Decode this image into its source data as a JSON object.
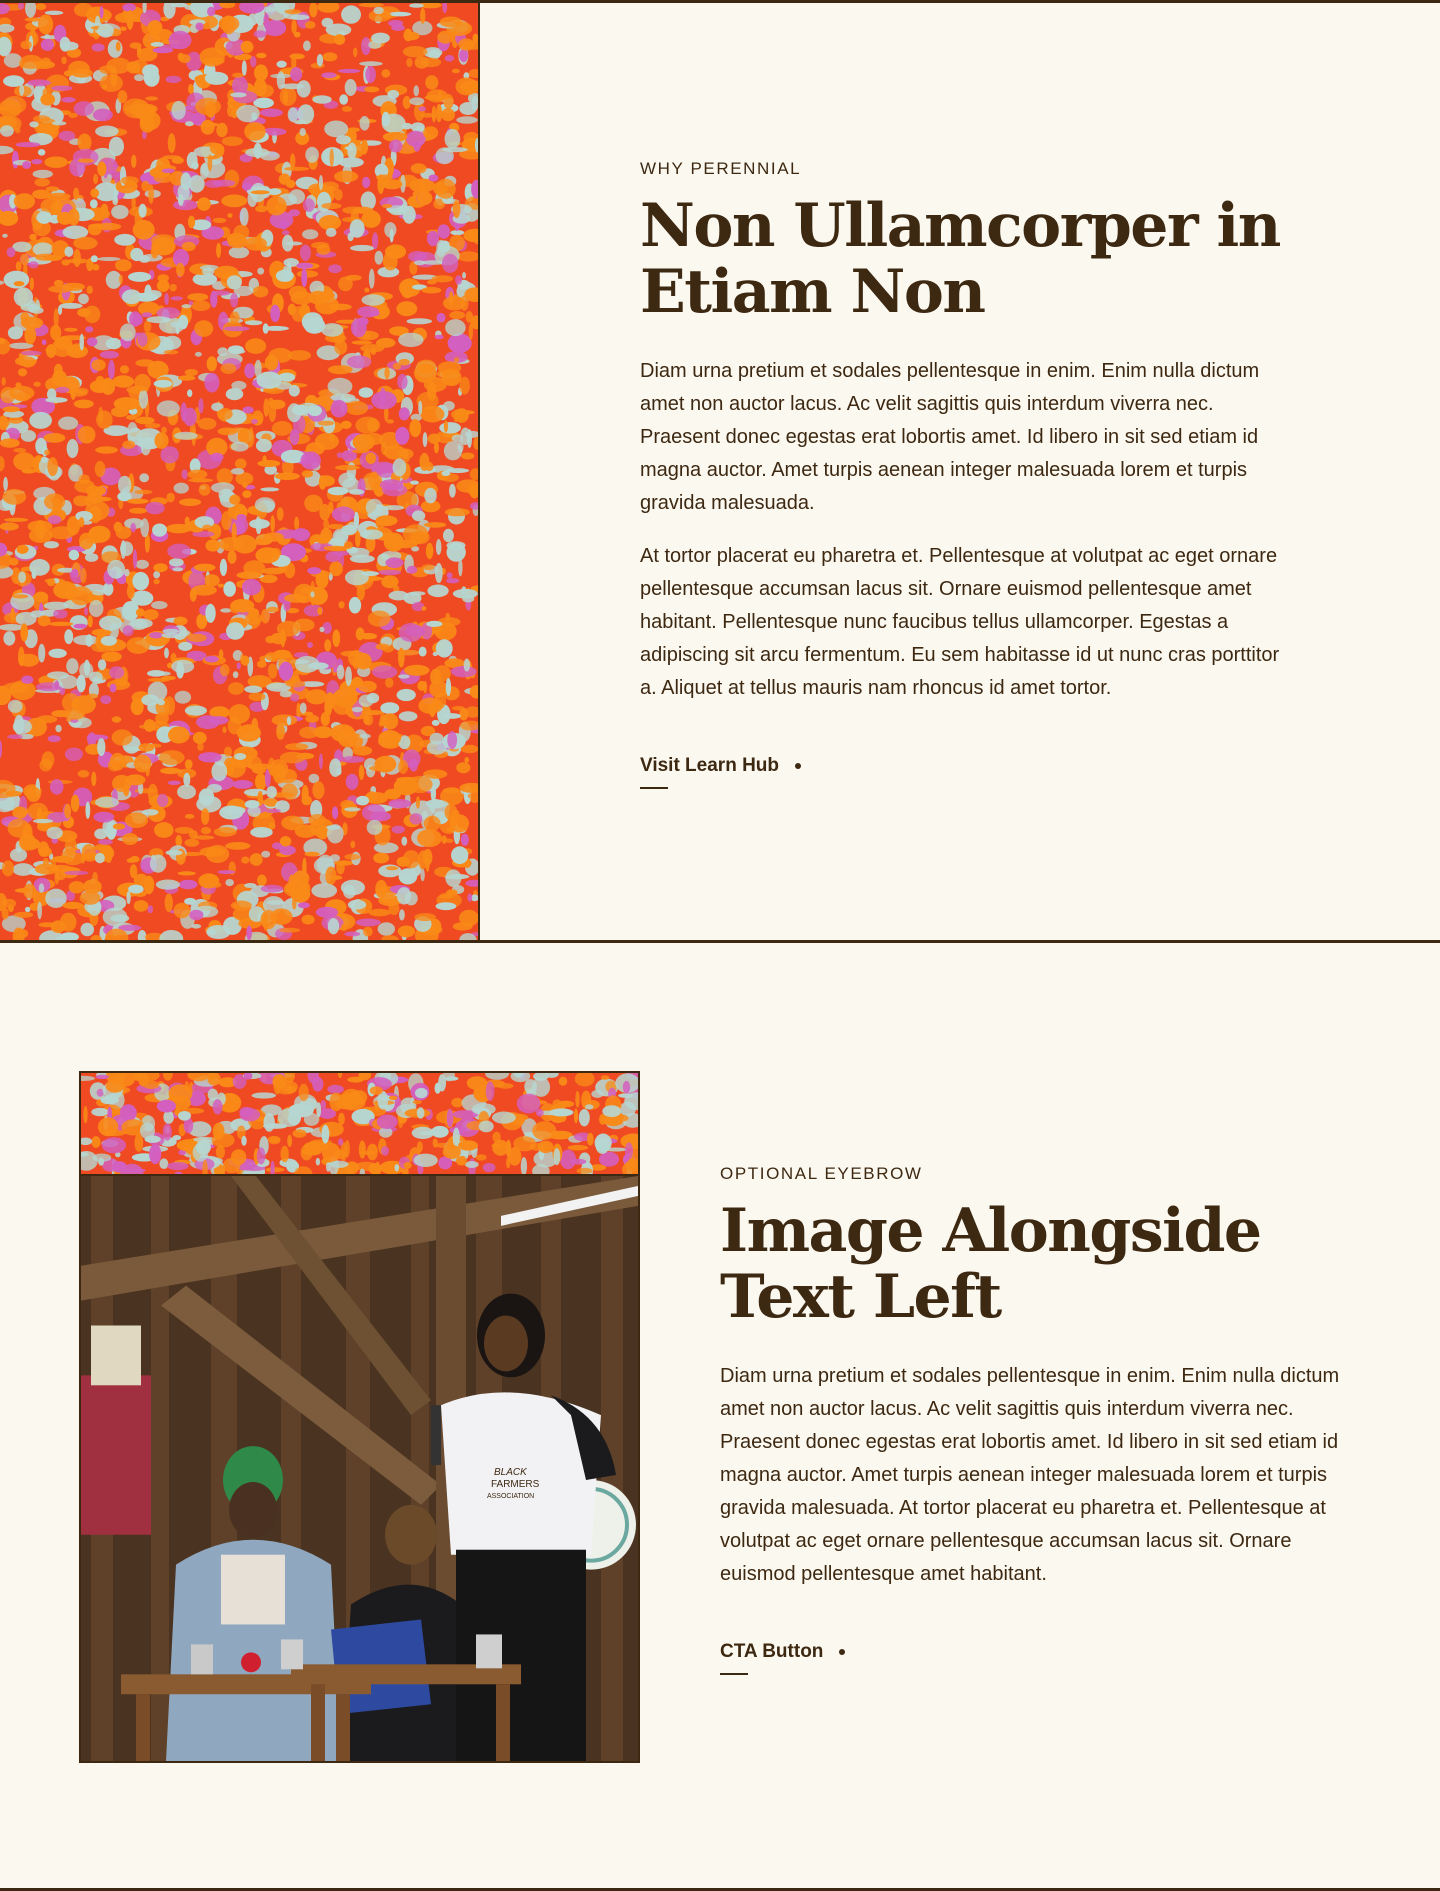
{
  "section1": {
    "eyebrow": "WHY PERENNIAL",
    "headline_line1": "Non Ullamcorper in",
    "headline_line2": "Etiam Non",
    "paragraph1": "Diam urna pretium et sodales pellentesque in enim. Enim nulla dictum amet non auctor lacus. Ac velit sagittis quis interdum viverra nec. Praesent donec egestas erat lobortis amet. Id libero in sit sed etiam id magna auctor. Amet turpis aenean integer malesuada lorem et turpis gravida malesuada.",
    "paragraph2": "At tortor placerat eu pharetra et. Pellentesque at volutpat ac eget ornare pellentesque accumsan lacus sit. Ornare euismod pellentesque amet habitant. Pellentesque nunc faucibus tellus ullamcorper. Egestas a adipiscing sit arcu fermentum. Eu sem habitasse id ut nunc cras porttitor a. Aliquet at tellus mauris nam rhoncus id amet tortor.",
    "cta_label": "Visit Learn Hub"
  },
  "section2": {
    "eyebrow": "OPTIONAL EYEBROW",
    "headline_line1": "Image Alongside",
    "headline_line2": "Text Left",
    "paragraph": "Diam urna pretium et sodales pellentesque in enim. Enim nulla dictum amet non auctor lacus. Ac velit sagittis quis interdum viverra nec. Praesent donec egestas erat lobortis amet. Id libero in sit sed etiam id magna auctor. Amet turpis aenean integer malesuada lorem et turpis gravida malesuada. At tortor placerat eu pharetra et. Pellentesque at volutpat ac eget ornare pellentesque accumsan lacus sit. Ornare euismod pellentesque amet habitant.",
    "cta_label": "CTA Button",
    "photo_shirt_text": [
      "BLACK",
      "FARMERS",
      "ASSOCIATION"
    ]
  },
  "colors": {
    "background": "#fbf8ef",
    "text": "#3d2812",
    "pattern_red": "#f04a22",
    "pattern_orange": "#f98a17",
    "pattern_pink": "#d35fc0",
    "pattern_blue": "#b6d6d1"
  },
  "icons": {
    "cta_dot": "dot-icon"
  }
}
